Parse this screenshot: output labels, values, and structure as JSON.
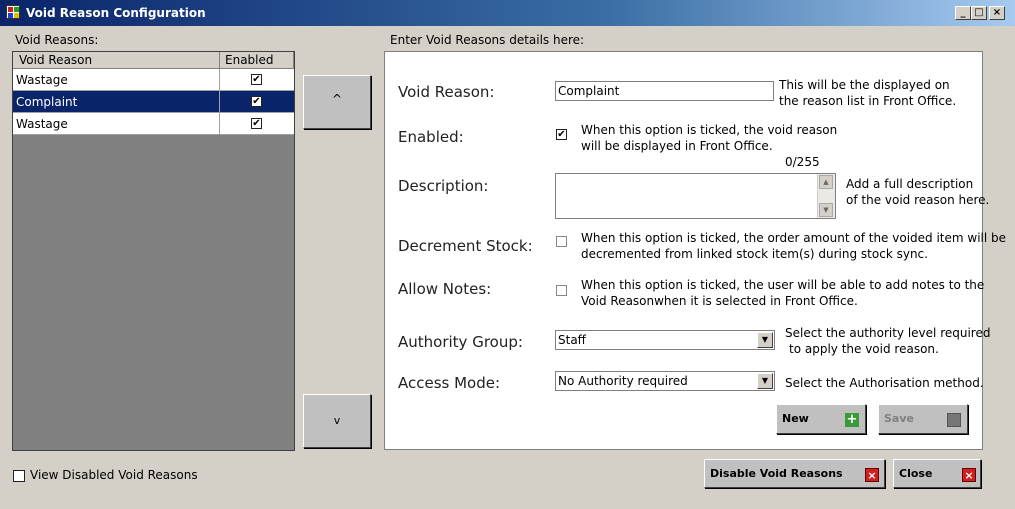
{
  "window": {
    "title": "Void Reason Configuration",
    "controls": [
      "_",
      "□",
      "×"
    ]
  },
  "left": {
    "group_label": "Void Reasons:",
    "columns": [
      "Void Reason",
      "Enabled"
    ],
    "rows": [
      {
        "name": "Wastage",
        "enabled": true,
        "selected": false
      },
      {
        "name": "Complaint",
        "enabled": true,
        "selected": true
      },
      {
        "name": "Wastage",
        "enabled": true,
        "selected": false
      }
    ],
    "up_label": "^",
    "down_label": "v",
    "view_disabled_label": "View Disabled Void Reasons"
  },
  "details": {
    "header": "Enter Void Reasons details here:",
    "void_reason_label": "Void Reason:",
    "void_reason_value": "Complaint",
    "void_reason_help1": "This will be the displayed on",
    "void_reason_help2": "the reason list in Front Office.",
    "enabled_label": "Enabled:",
    "enabled_checked": true,
    "enabled_help1": "When this option is ticked, the void reason",
    "enabled_help2": "will be displayed in Front Office.",
    "char_count": "0/255",
    "description_label": "Description:",
    "description_value": "",
    "description_help1": "Add a full description",
    "description_help2": "of the void reason here.",
    "decrement_label": "Decrement Stock:",
    "decrement_checked": false,
    "decrement_help1": "When this option is ticked, the order amount of the voided item will be",
    "decrement_help2": "decremented from linked stock item(s) during stock sync.",
    "allow_notes_label": "Allow Notes:",
    "allow_notes_checked": false,
    "allow_notes_help1": "When this option is ticked, the user will be able to add notes to the",
    "allow_notes_help2": "Void Reasonwhen it is selected in Front Office.",
    "authority_label": "Authority Group:",
    "authority_value": "Staff",
    "authority_help1": "Select the authority level required",
    "authority_help2": "to apply the void reason.",
    "access_label": "Access Mode:",
    "access_value": "No Authority required",
    "access_help": "Select the Authorisation method.",
    "new_label": "New",
    "save_label": "Save"
  },
  "footer": {
    "disable_label": "Disable Void Reasons",
    "close_label": "Close"
  },
  "colors": {
    "title_start": "#0a246a",
    "selected_row": "#0a246a",
    "window_bg": "#d4d0c8",
    "close_icon": "#d02020",
    "new_icon": "#3a9a3a"
  }
}
